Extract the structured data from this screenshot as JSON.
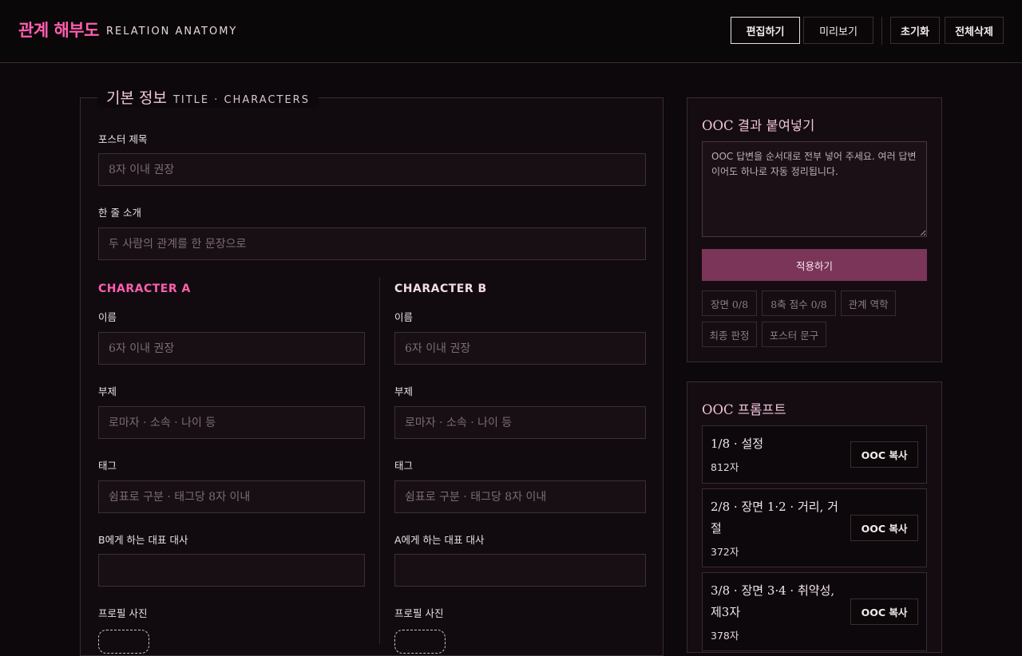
{
  "header": {
    "logo": "관계 해부도",
    "subtitle": "RELATION ANATOMY",
    "buttons": {
      "edit": "편집하기",
      "preview": "미리보기",
      "reset": "초기화",
      "delete_all": "전체삭제"
    }
  },
  "basic_info": {
    "legend_main": "기본 정보",
    "legend_sub": "TITLE · CHARACTERS",
    "poster_title_label": "포스터 제목",
    "poster_title_placeholder": "8자 이내 권장",
    "tagline_label": "한 줄 소개",
    "tagline_placeholder": "두 사람의 관계를 한 문장으로"
  },
  "character_a": {
    "heading": "CHARACTER A",
    "name_label": "이름",
    "name_placeholder": "6자 이내 권장",
    "subtitle_label": "부제",
    "subtitle_placeholder": "로마자 · 소속 · 나이 등",
    "tags_label": "태그",
    "tags_placeholder": "쉼표로 구분 · 태그당 8자 이내",
    "line_label": "B에게 하는 대표 대사",
    "line_value": "",
    "photo_label": "프로필 사진"
  },
  "character_b": {
    "heading": "CHARACTER B",
    "name_label": "이름",
    "name_placeholder": "6자 이내 권장",
    "subtitle_label": "부제",
    "subtitle_placeholder": "로마자 · 소속 · 나이 등",
    "tags_label": "태그",
    "tags_placeholder": "쉼표로 구분 · 태그당 8자 이내",
    "line_label": "A에게 하는 대표 대사",
    "line_value": "",
    "photo_label": "프로필 사진"
  },
  "ooc_paste": {
    "title": "OOC 결과 붙여넣기",
    "placeholder": "OOC 답변을 순서대로 전부 넣어 주세요. 여러 답변이어도 하나로 자동 정리됩니다.",
    "apply_button": "적용하기",
    "chips": [
      "장면 0/8",
      "8축 점수 0/8",
      "관계 역학",
      "최종 판정",
      "포스터 문구"
    ]
  },
  "ooc_prompts": {
    "title": "OOC 프롬프트",
    "items": [
      {
        "title": "1/8 · 설정",
        "count": "812자",
        "button": "OOC 복사"
      },
      {
        "title": "2/8 · 장면 1·2 · 거리, 거절",
        "count": "372자",
        "button": "OOC 복사"
      },
      {
        "title": "3/8 · 장면 3·4 · 취약성, 제3자",
        "count": "378자",
        "button": "OOC 복사"
      }
    ]
  },
  "colors": {
    "accent_pink": "#ff5fae",
    "button_plum": "#7a3558",
    "background": "#0c080b"
  }
}
